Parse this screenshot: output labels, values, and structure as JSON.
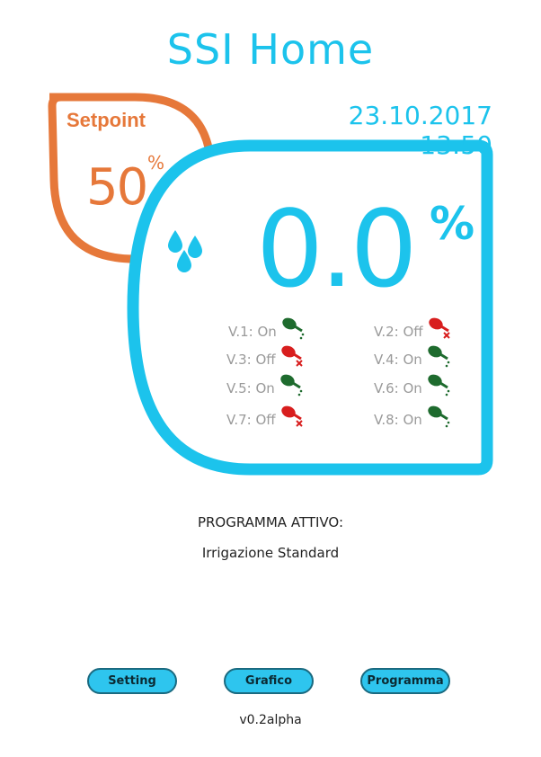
{
  "header": {
    "title": "SSI Home",
    "datetime": "23.10.2017 13:50"
  },
  "setpoint": {
    "label": "Setpoint",
    "value": "50",
    "unit": "%",
    "accent_color": "#e6783a"
  },
  "humidity": {
    "value": "0.0",
    "unit": "%",
    "accent_color": "#1cc3ec",
    "icon": "water-drops-icon"
  },
  "valves": [
    {
      "label": "V.1: On",
      "state": "on",
      "icon": "watering-can-on-icon"
    },
    {
      "label": "V.2: Off",
      "state": "off",
      "icon": "watering-can-off-icon"
    },
    {
      "label": "V.3: Off",
      "state": "off",
      "icon": "watering-can-off-icon"
    },
    {
      "label": "V.4: On",
      "state": "on",
      "icon": "watering-can-on-icon"
    },
    {
      "label": "V.5: On",
      "state": "on",
      "icon": "watering-can-on-icon"
    },
    {
      "label": "V.6: On",
      "state": "on",
      "icon": "watering-can-on-icon"
    },
    {
      "label": "V.7: Off",
      "state": "off",
      "icon": "watering-can-off-icon"
    },
    {
      "label": "V.8: On",
      "state": "on",
      "icon": "watering-can-on-icon"
    }
  ],
  "status_colors": {
    "on": "#1e6b2e",
    "off": "#d81e1e"
  },
  "program": {
    "title": "PROGRAMMA ATTIVO:",
    "name": "Irrigazione Standard"
  },
  "buttons": {
    "setting": "Setting",
    "grafico": "Grafico",
    "programma": "Programma"
  },
  "footer": {
    "version": "v0.2alpha"
  }
}
